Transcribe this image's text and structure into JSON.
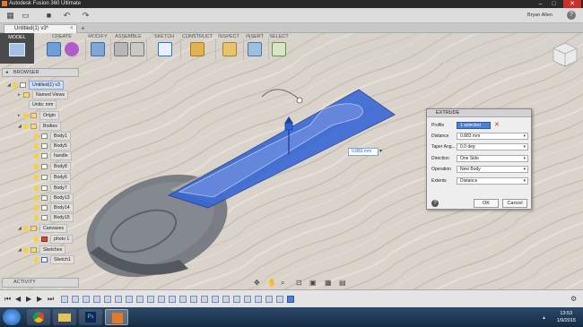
{
  "window": {
    "title": "Autodesk Fusion 360 Ultimate",
    "user": "Bryan Allen",
    "help": "?"
  },
  "doc_tab": {
    "title": "Untitled(1) v3*"
  },
  "toolbar": {
    "model": "MODEL",
    "groups": [
      "CREATE",
      "MODIFY",
      "ASSEMBLE",
      "SKETCH",
      "CONSTRUCT",
      "INSPECT",
      "INSERT",
      "SELECT"
    ]
  },
  "browser": {
    "title": "BROWSER",
    "root": "Untitled(1) v3",
    "named_views": "Named Views",
    "units": "Units: mm",
    "origin": "Origin",
    "bodies": "Bodies",
    "body_items": [
      "Body1",
      "Body5",
      "handle",
      "Body8",
      "Body6",
      "Body7",
      "Body13",
      "Body14",
      "Body15"
    ],
    "canvases": "Canvases",
    "photo": "photo 1",
    "sketches": "Sketches",
    "sketch1": "Sketch1"
  },
  "viewport": {
    "distance_label": "0.883 mm"
  },
  "extrude": {
    "title": "EXTRUDE",
    "rows": [
      {
        "k": "Profile",
        "v": "1 selected"
      },
      {
        "k": "Distance",
        "v": "0.883 mm"
      },
      {
        "k": "Taper Ang...",
        "v": "0.0 deg"
      },
      {
        "k": "Direction",
        "v": "One Side"
      },
      {
        "k": "Operation",
        "v": "New Body"
      },
      {
        "k": "Extents",
        "v": "Distance"
      }
    ],
    "ok": "OK",
    "cancel": "Cancel"
  },
  "activity": {
    "title": "ACTIVITY"
  },
  "taskbar": {
    "time": "13:53",
    "date": "1/9/2015"
  },
  "colors": {
    "accent": "#2f6fd0",
    "profile_blue": "#2f63d8",
    "wood": "#d9d2c6"
  }
}
